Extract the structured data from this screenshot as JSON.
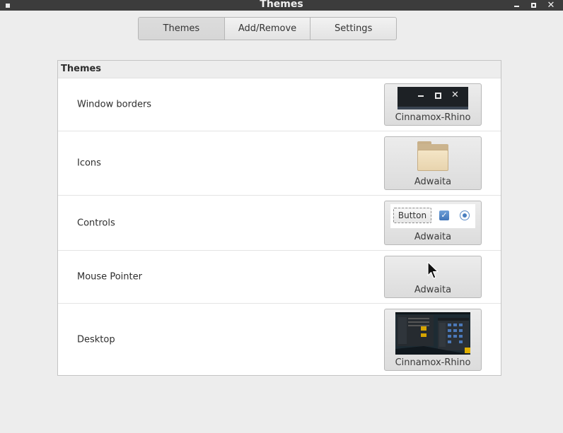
{
  "window": {
    "title": "Themes"
  },
  "tabs": [
    {
      "label": "Themes",
      "active": true
    },
    {
      "label": "Add/Remove",
      "active": false
    },
    {
      "label": "Settings",
      "active": false
    }
  ],
  "panel": {
    "header": "Themes",
    "rows": [
      {
        "label": "Window borders",
        "theme": "Cinnamox-Rhino",
        "preview": "window-borders-preview"
      },
      {
        "label": "Icons",
        "theme": "Adwaita",
        "preview": "folder-icon"
      },
      {
        "label": "Controls",
        "theme": "Adwaita",
        "preview": "controls-preview",
        "preview_button_label": "Button"
      },
      {
        "label": "Mouse Pointer",
        "theme": "Adwaita",
        "preview": "pointer-icon"
      },
      {
        "label": "Desktop",
        "theme": "Cinnamox-Rhino",
        "preview": "desktop-screenshot"
      }
    ]
  },
  "colors": {
    "titlebar": "#3c3c3c",
    "background": "#ededed",
    "accent": "#4a7fc0",
    "desktop_highlight": "#e0b000"
  }
}
